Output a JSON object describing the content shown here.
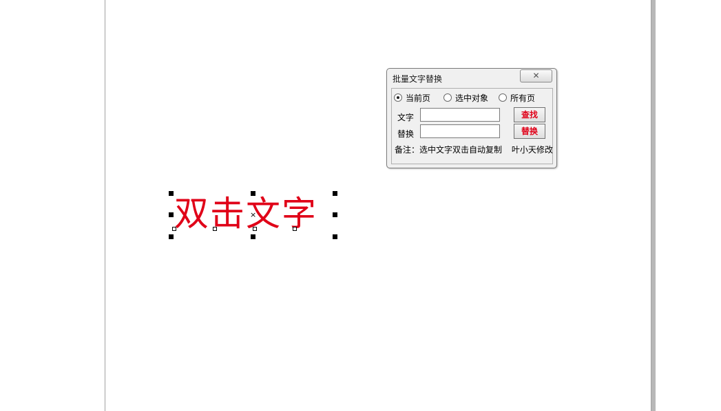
{
  "canvas": {
    "text_object": "双击文字",
    "text_color": "#e00018"
  },
  "dialog": {
    "title": "批量文字替换",
    "close_icon": "✕",
    "scope_options": [
      {
        "label": "当前页",
        "checked": true
      },
      {
        "label": "选中对象",
        "checked": false
      },
      {
        "label": "所有页",
        "checked": false
      }
    ],
    "text_label": "文字",
    "replace_label": "替换",
    "text_value": "",
    "replace_value": "",
    "find_button": "查找",
    "replace_button": "替换",
    "note": "备注：选中文字双击自动复制",
    "author": "叶小天修改"
  }
}
